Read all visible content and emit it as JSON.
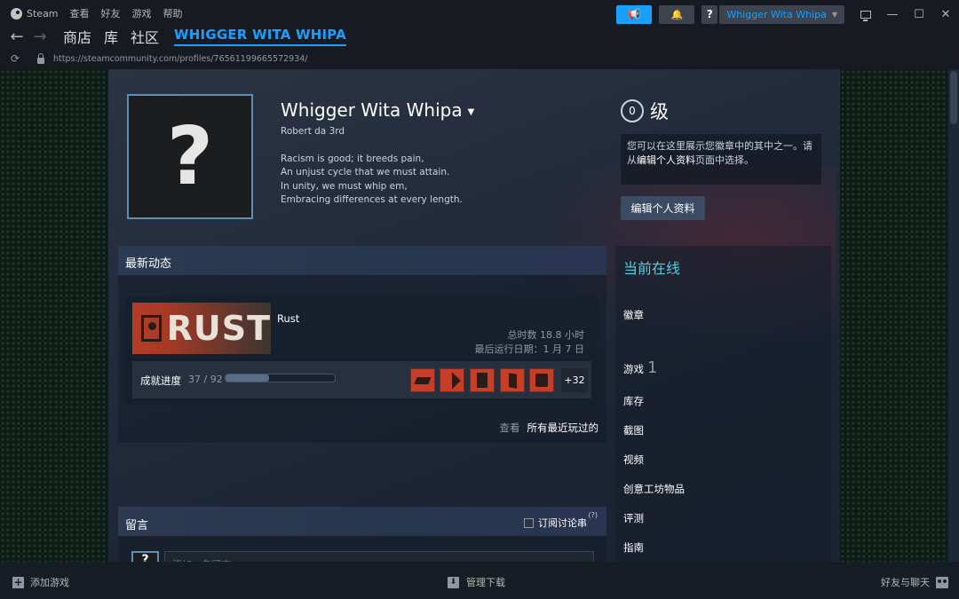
{
  "menu": {
    "app_name": "Steam",
    "items": [
      "查看",
      "好友",
      "游戏",
      "帮助"
    ]
  },
  "titlebar": {
    "help_label": "?",
    "user_name": "Whigger Wita Whipa"
  },
  "nav": {
    "links": [
      "商店",
      "库",
      "社区"
    ],
    "current_title": "WHIGGER WITA WHIPA",
    "url": "https://steamcommunity.com/profiles/76561199665572934/"
  },
  "profile": {
    "avatar_glyph": "?",
    "persona_name": "Whigger Wita Whipa",
    "real_name": "Robert da 3rd",
    "summary_lines": [
      "Racism is good; it breeds pain,",
      "An unjust cycle that we must attain.",
      "In unity, we must whip em,",
      "Embracing differences at every length."
    ],
    "level": "0",
    "level_label": "级",
    "badge_note_pre": "您可以在这里展示您徽章中的其中之一。请从",
    "badge_note_link": "编辑个人资料",
    "badge_note_post": "页面中选择。",
    "edit_button": "编辑个人资料"
  },
  "recent_activity": {
    "title": "最新动态",
    "game": {
      "logo_text": "RUST",
      "name": "Rust",
      "total_hours": "总时数 18.8 小时",
      "last_played": "最后运行日期：1 月 7 日"
    },
    "achievements": {
      "label": "成就进度",
      "count": "37 / 92",
      "progress_fraction": 0.402,
      "icons": [
        "achievement-icon-1",
        "achievement-icon-2",
        "achievement-icon-3",
        "achievement-icon-4",
        "achievement-icon-5"
      ],
      "more": "+32"
    },
    "view_label": "查看",
    "view_all_label": "所有最近玩过的"
  },
  "comments": {
    "title": "留言",
    "subscribe_label": "订阅讨论串",
    "subscribe_help": "(?)",
    "avatar_glyph": "?",
    "input_placeholder": "添加一条留言"
  },
  "sidebar": {
    "status": "当前在线",
    "badges_label": "徽章",
    "games_label": "游戏",
    "games_count": "1",
    "links": [
      "库存",
      "截图",
      "视频",
      "创意工坊物品",
      "评测",
      "指南"
    ]
  },
  "bottom": {
    "add_game": "添加游戏",
    "manage_downloads": "管理下载",
    "friends_chat": "好友与聊天"
  },
  "colors": {
    "accent_blue": "#1a9fff",
    "online_cyan": "#57cbde",
    "rust_orange": "#c63e25",
    "page_bg": "#1b2838"
  }
}
